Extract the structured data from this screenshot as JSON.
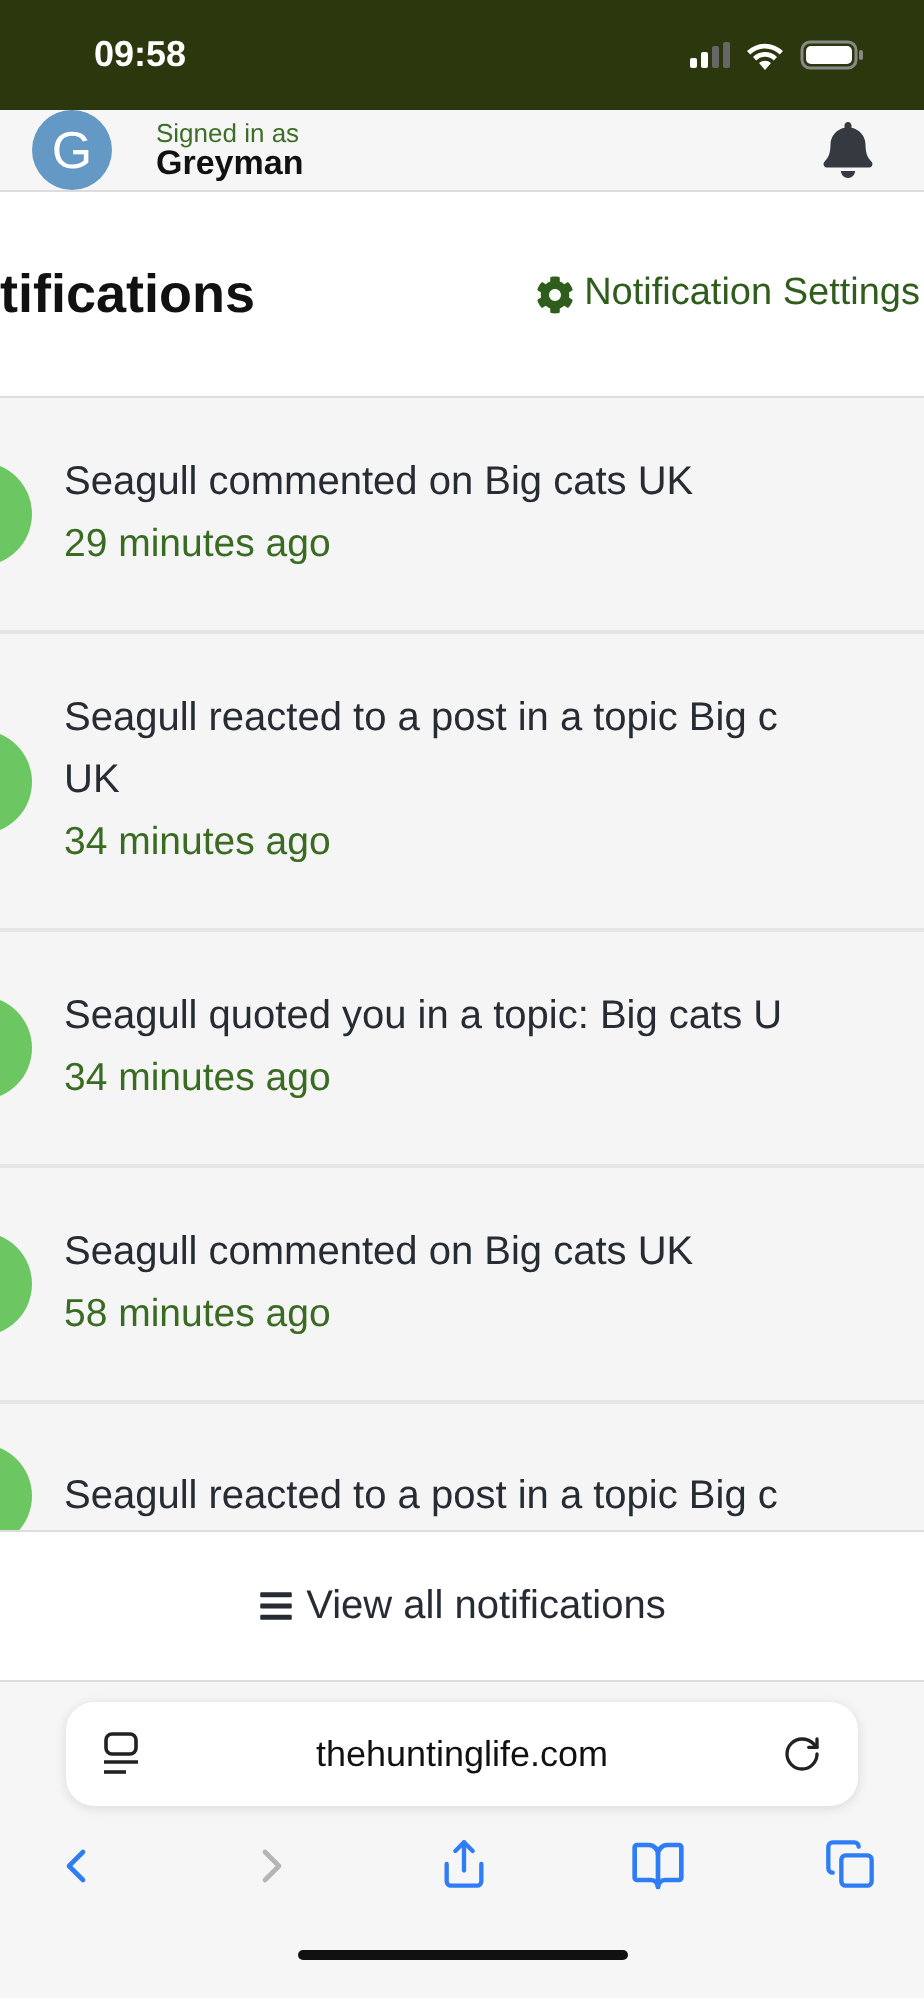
{
  "status_bar": {
    "time": "09:58"
  },
  "header": {
    "signed_in_label": "Signed in as",
    "username": "Greyman",
    "avatar_letter": "G"
  },
  "panel": {
    "title": "tifications",
    "settings_link": "Notification Settings"
  },
  "notifications": [
    {
      "lines": [
        "Seagull commented on Big cats UK"
      ],
      "time": "29 minutes ago"
    },
    {
      "lines": [
        "Seagull reacted to a post in a topic Big c",
        "UK"
      ],
      "time": "34 minutes ago"
    },
    {
      "lines": [
        "Seagull quoted you in a topic: Big cats U"
      ],
      "time": "34 minutes ago"
    },
    {
      "lines": [
        "Seagull commented on Big cats UK"
      ],
      "time": "58 minutes ago"
    },
    {
      "lines": [
        "Seagull reacted to a post in a topic Big c"
      ]
    }
  ],
  "footer": {
    "view_all": "View all notifications"
  },
  "browser": {
    "url": "thehuntinglife.com",
    "nav": [
      {
        "kind": "back",
        "disabled": false
      },
      {
        "kind": "forward",
        "disabled": true
      },
      {
        "kind": "share",
        "disabled": false
      },
      {
        "kind": "bookmarks",
        "disabled": false
      },
      {
        "kind": "tabs",
        "disabled": false
      }
    ]
  }
}
